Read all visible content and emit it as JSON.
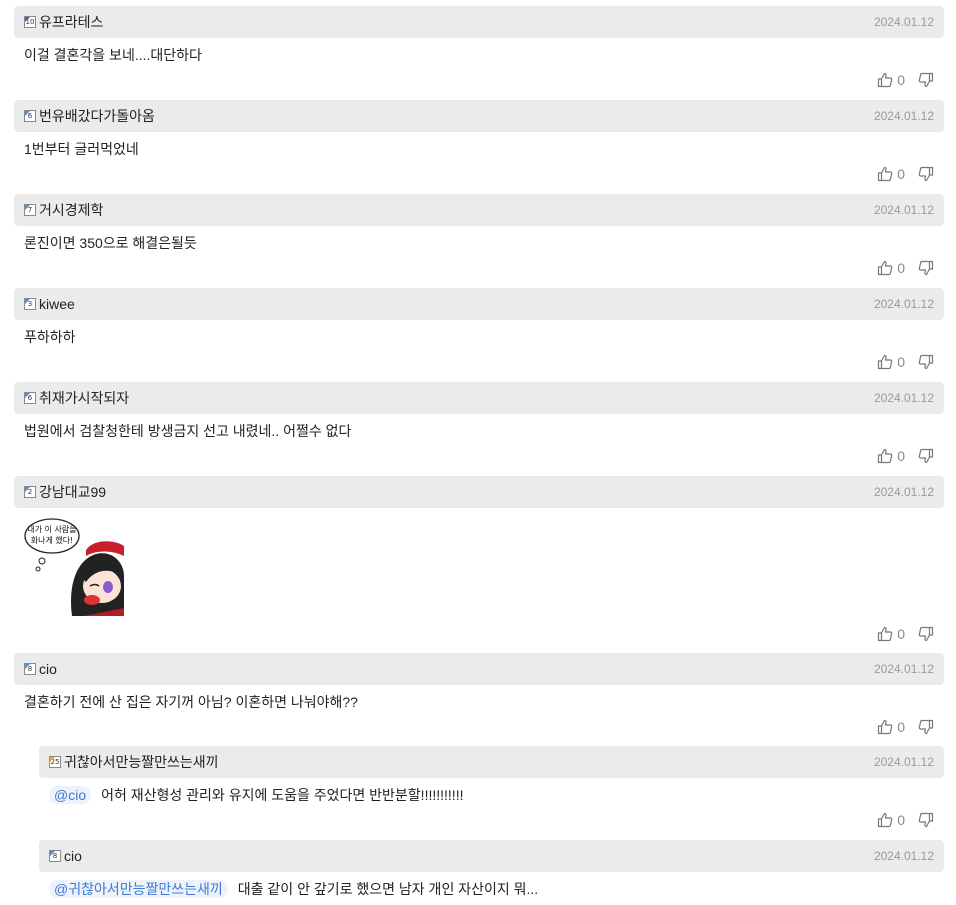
{
  "comments": [
    {
      "level": "10",
      "level_color": "#7b3fb0",
      "nick": "유프라테스",
      "date": "2024.01.12",
      "text": "이걸 결혼각을 보네....대단하다",
      "likes": "0"
    },
    {
      "level": "6",
      "level_color": "#4a90d9",
      "nick": "번유배갔다가돌아옴",
      "date": "2024.01.12",
      "text": "1번부터 글러먹었네",
      "likes": "0"
    },
    {
      "level": "7",
      "level_color": "#4a90d9",
      "nick": "거시경제학",
      "date": "2024.01.12",
      "text": "론진이면 350으로 해결은될듯",
      "likes": "0"
    },
    {
      "level": "3",
      "level_color": "#4a90d9",
      "nick": "kiwee",
      "date": "2024.01.12",
      "text": "푸하하하",
      "likes": "0"
    },
    {
      "level": "6",
      "level_color": "#4a90d9",
      "nick": "취재가시작되자",
      "date": "2024.01.12",
      "text": "법원에서 검찰청한테 방생금지 선고 내렸네.. 어쩔수 없다",
      "likes": "0"
    },
    {
      "level": "2",
      "level_color": "#4a90d9",
      "nick": "강남대교99",
      "date": "2024.01.12",
      "sticker_text": "내가 이 사람을 화나게 했다!",
      "likes": "0"
    },
    {
      "level": "8",
      "level_color": "#4a90d9",
      "nick": "cio",
      "date": "2024.01.12",
      "text": "결혼하기 전에 산 집은 자기꺼 아님? 이혼하면 나눠야해??",
      "likes": "0"
    }
  ],
  "replies": [
    {
      "level": "25",
      "level_color": "#e6b422",
      "nick": "귀찮아서만능짤만쓰는새끼",
      "date": "2024.01.12",
      "mention": "@cio",
      "text": "어허 재산형성 관리와 유지에 도움을 주었다면 반반분할!!!!!!!!!!!",
      "likes": "0"
    },
    {
      "level": "8",
      "level_color": "#4a90d9",
      "nick": "cio",
      "date": "2024.01.12",
      "mention": "@귀찮아서만능짤만쓰는새끼",
      "text": "대출 같이 안 갚기로 했으면 남자 개인 자산이지 뭐..."
    }
  ],
  "icons": {
    "like": "thumbs-up-icon",
    "dislike": "thumbs-down-icon",
    "level": "level-badge-icon"
  }
}
